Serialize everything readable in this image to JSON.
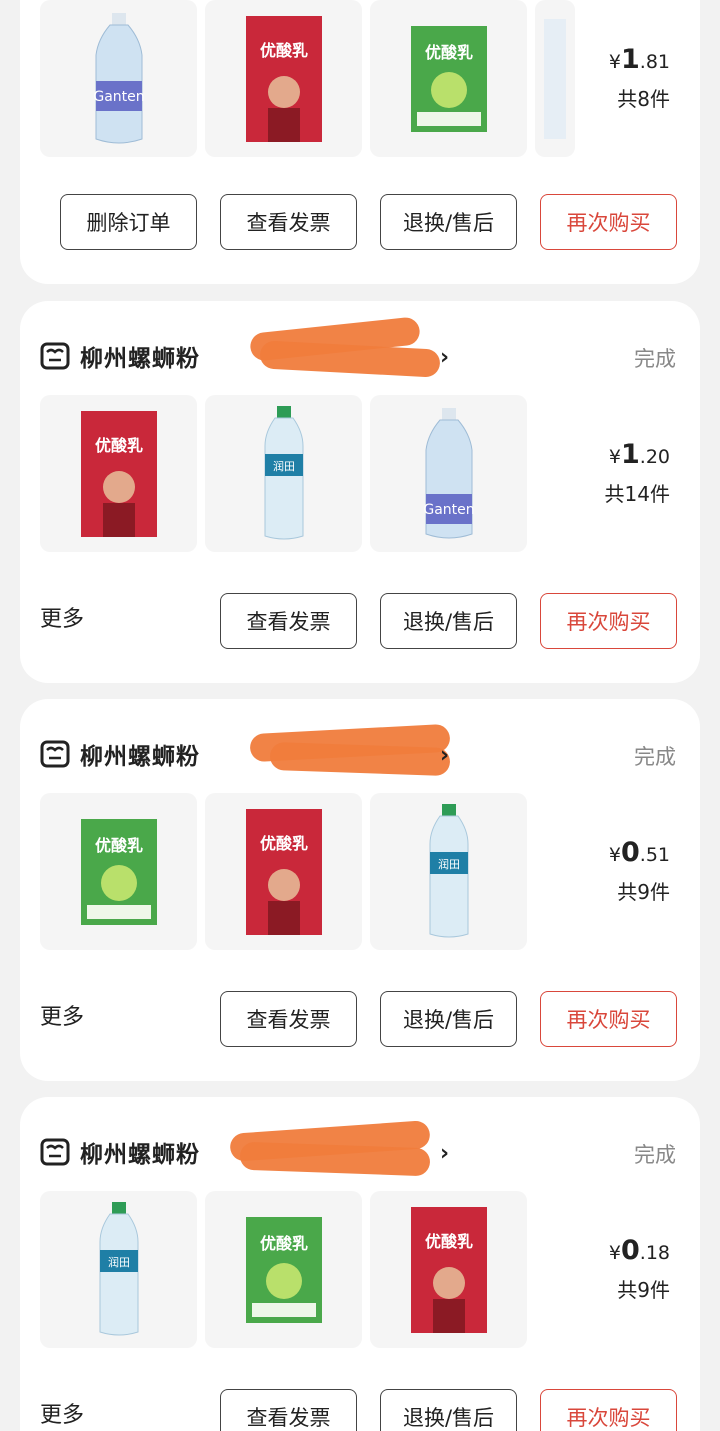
{
  "colors": {
    "accent": "#d9473b",
    "status": "#888888",
    "redaction": "#f07c3c"
  },
  "orders": [
    {
      "price_symbol": "¥",
      "price_int": "1",
      "price_dec": ".81",
      "count_text": "共8件",
      "items": [
        "Ganten bottled water",
        "优酸乳 strawberry",
        "优酸乳 apple",
        "bottle (partial)"
      ],
      "buttons": [
        "删除订单",
        "查看发票",
        "退换/售后",
        "再次购买"
      ]
    },
    {
      "shop_name": "柳州螺蛳粉",
      "status": "完成",
      "price_symbol": "¥",
      "price_int": "1",
      "price_dec": ".20",
      "count_text": "共14件",
      "more": "更多",
      "items": [
        "优酸乳 strawberry",
        "润田 water",
        "Ganten bottled water"
      ],
      "buttons": [
        "查看发票",
        "退换/售后",
        "再次购买"
      ]
    },
    {
      "shop_name": "柳州螺蛳粉",
      "status": "完成",
      "price_symbol": "¥",
      "price_int": "0",
      "price_dec": ".51",
      "count_text": "共9件",
      "more": "更多",
      "items": [
        "优酸乳 apple",
        "优酸乳 strawberry",
        "润田 water"
      ],
      "buttons": [
        "查看发票",
        "退换/售后",
        "再次购买"
      ]
    },
    {
      "shop_name": "柳州螺蛳粉",
      "status": "完成",
      "price_symbol": "¥",
      "price_int": "0",
      "price_dec": ".18",
      "count_text": "共9件",
      "more": "更多",
      "items": [
        "润田 water",
        "优酸乳 apple",
        "优酸乳 strawberry"
      ],
      "buttons": [
        "查看发票",
        "退换/售后",
        "再次购买"
      ]
    }
  ],
  "product_texts": {
    "yogurt": "优酸乳",
    "runtian": "润田",
    "ganten": "Ganten"
  }
}
